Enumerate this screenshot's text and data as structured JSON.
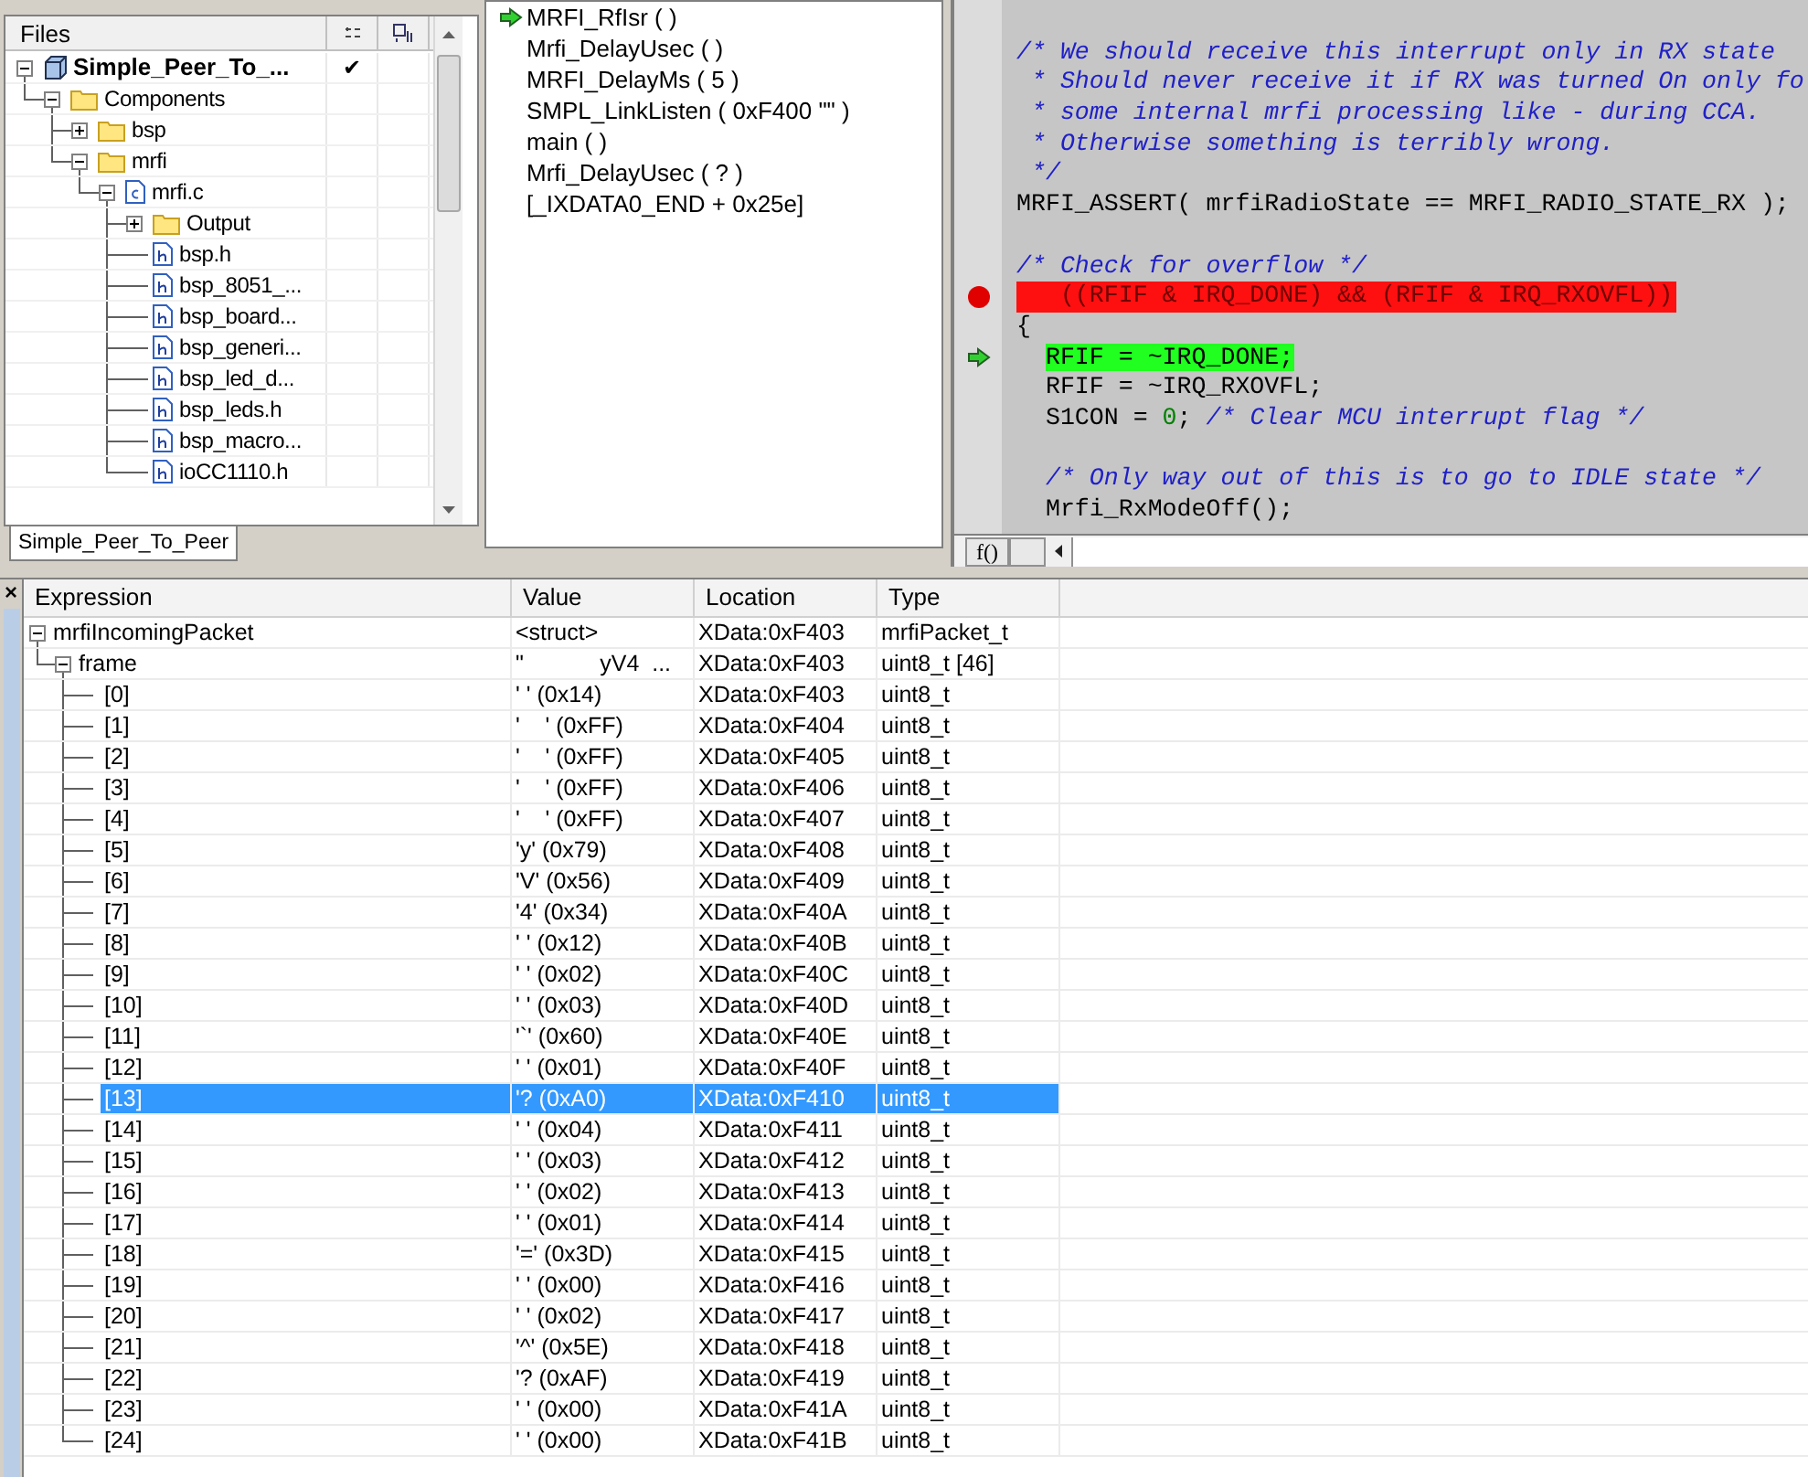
{
  "files_panel": {
    "title": "Files",
    "tree": [
      {
        "label": "Simple_Peer_To_...",
        "kind": "project",
        "expanded": true,
        "check": "✔",
        "children": [
          {
            "label": "Components",
            "kind": "folder",
            "expanded": true,
            "children": [
              {
                "label": "bsp",
                "kind": "folder",
                "expanded": false
              },
              {
                "label": "mrfi",
                "kind": "folder",
                "expanded": true,
                "children": [
                  {
                    "label": "mrfi.c",
                    "kind": "c-file",
                    "expanded": true,
                    "children": [
                      {
                        "label": "Output",
                        "kind": "folder",
                        "expanded": false
                      },
                      {
                        "label": "bsp.h",
                        "kind": "h-file"
                      },
                      {
                        "label": "bsp_8051_...",
                        "kind": "h-file"
                      },
                      {
                        "label": "bsp_board...",
                        "kind": "h-file"
                      },
                      {
                        "label": "bsp_generi...",
                        "kind": "h-file"
                      },
                      {
                        "label": "bsp_led_d...",
                        "kind": "h-file"
                      },
                      {
                        "label": "bsp_leds.h",
                        "kind": "h-file"
                      },
                      {
                        "label": "bsp_macro...",
                        "kind": "h-file"
                      },
                      {
                        "label": "ioCC1110.h",
                        "kind": "h-file"
                      }
                    ]
                  }
                ]
              }
            ]
          }
        ]
      }
    ],
    "tabs": [
      {
        "label": "Simple_Peer_To_Peer",
        "selected": true
      }
    ]
  },
  "call_stack": [
    {
      "label": "MRFI_RfIsr ( )",
      "current": true
    },
    {
      "label": "Mrfi_DelayUsec ( )",
      "current": false
    },
    {
      "label": "MRFI_DelayMs ( 5 )",
      "current": false
    },
    {
      "label": "SMPL_LinkListen ( 0xF400 \"\" )",
      "current": false
    },
    {
      "label": "main ( )",
      "current": false
    },
    {
      "label": "Mrfi_DelayUsec ( ? )",
      "current": false
    },
    {
      "label": "[_IXDATA0_END + 0x25e]",
      "current": false
    }
  ],
  "editor": {
    "lines": [
      {
        "blank_line_before": true,
        "segments": [
          {
            "kind": "comment",
            "text": "/* We should receive this interrupt only in RX state"
          }
        ]
      },
      {
        "segments": [
          {
            "kind": "comment",
            "text": " * Should never receive it if RX was turned On only fo"
          }
        ]
      },
      {
        "segments": [
          {
            "kind": "comment",
            "text": " * some internal mrfi processing like - during CCA."
          }
        ]
      },
      {
        "segments": [
          {
            "kind": "comment",
            "text": " * Otherwise something is terribly wrong."
          }
        ]
      },
      {
        "segments": [
          {
            "kind": "comment",
            "text": " */"
          }
        ]
      },
      {
        "segments": [
          {
            "kind": "code",
            "text": "MRFI_ASSERT( mrfiRadioState == MRFI_RADIO_STATE_RX );"
          }
        ]
      },
      {
        "blank_line_before": true,
        "segments": [
          {
            "kind": "comment",
            "text": "/* Check for overflow */"
          }
        ]
      },
      {
        "breakpoint": true,
        "segments": [
          {
            "kind": "code",
            "text": "   ((RFIF & IRQ_DONE) && (RFIF & IRQ_RXOVFL))"
          }
        ]
      },
      {
        "segments": [
          {
            "kind": "code",
            "text": "{"
          }
        ]
      },
      {
        "current": true,
        "segments": [
          {
            "kind": "code",
            "text": "  RFIF = ~IRQ_DONE;"
          }
        ]
      },
      {
        "segments": [
          {
            "kind": "code",
            "text": "  RFIF = ~IRQ_RXOVFL;"
          }
        ]
      },
      {
        "segments": [
          {
            "kind": "code",
            "text": "  S1CON = "
          },
          {
            "kind": "number",
            "text": "0"
          },
          {
            "kind": "code",
            "text": "; "
          },
          {
            "kind": "comment",
            "text": "/* Clear MCU interrupt flag */"
          }
        ]
      },
      {
        "blank_line_before": true,
        "segments": [
          {
            "kind": "comment",
            "text": "  /* Only way out of this is to go to IDLE state */"
          }
        ]
      },
      {
        "segments": [
          {
            "kind": "code",
            "text": "  Mrfi_RxModeOff();"
          }
        ]
      }
    ],
    "bottom_button": "f()"
  },
  "watch": {
    "close": "×",
    "columns": [
      "Expression",
      "Value",
      "Location",
      "Type"
    ],
    "rows": [
      {
        "expression": "mrfiIncomingPacket",
        "value": "<struct>",
        "location": "XData:0xF403",
        "type": "mrfiPacket_t",
        "expanded": true,
        "selected": false,
        "children": [
          {
            "expression": "frame",
            "value": "\"            yV4  ...",
            "location": "XData:0xF403",
            "type": "uint8_t [46]",
            "expanded": true,
            "selected": false,
            "children": [
              {
                "expression": "[0]",
                "value": "' ' (0x14)",
                "location": "XData:0xF403",
                "type": "uint8_t",
                "selected": false
              },
              {
                "expression": "[1]",
                "value": "'    ' (0xFF)",
                "location": "XData:0xF404",
                "type": "uint8_t",
                "selected": false
              },
              {
                "expression": "[2]",
                "value": "'    ' (0xFF)",
                "location": "XData:0xF405",
                "type": "uint8_t",
                "selected": false
              },
              {
                "expression": "[3]",
                "value": "'    ' (0xFF)",
                "location": "XData:0xF406",
                "type": "uint8_t",
                "selected": false
              },
              {
                "expression": "[4]",
                "value": "'    ' (0xFF)",
                "location": "XData:0xF407",
                "type": "uint8_t",
                "selected": false
              },
              {
                "expression": "[5]",
                "value": "'y' (0x79)",
                "location": "XData:0xF408",
                "type": "uint8_t",
                "selected": false
              },
              {
                "expression": "[6]",
                "value": "'V' (0x56)",
                "location": "XData:0xF409",
                "type": "uint8_t",
                "selected": false
              },
              {
                "expression": "[7]",
                "value": "'4' (0x34)",
                "location": "XData:0xF40A",
                "type": "uint8_t",
                "selected": false
              },
              {
                "expression": "[8]",
                "value": "' ' (0x12)",
                "location": "XData:0xF40B",
                "type": "uint8_t",
                "selected": false
              },
              {
                "expression": "[9]",
                "value": "' ' (0x02)",
                "location": "XData:0xF40C",
                "type": "uint8_t",
                "selected": false
              },
              {
                "expression": "[10]",
                "value": "' ' (0x03)",
                "location": "XData:0xF40D",
                "type": "uint8_t",
                "selected": false
              },
              {
                "expression": "[11]",
                "value": "'`' (0x60)",
                "location": "XData:0xF40E",
                "type": "uint8_t",
                "selected": false
              },
              {
                "expression": "[12]",
                "value": "' ' (0x01)",
                "location": "XData:0xF40F",
                "type": "uint8_t",
                "selected": false
              },
              {
                "expression": "[13]",
                "value": "'? (0xA0)",
                "location": "XData:0xF410",
                "type": "uint8_t",
                "selected": true
              },
              {
                "expression": "[14]",
                "value": "' ' (0x04)",
                "location": "XData:0xF411",
                "type": "uint8_t",
                "selected": false
              },
              {
                "expression": "[15]",
                "value": "' ' (0x03)",
                "location": "XData:0xF412",
                "type": "uint8_t",
                "selected": false
              },
              {
                "expression": "[16]",
                "value": "' ' (0x02)",
                "location": "XData:0xF413",
                "type": "uint8_t",
                "selected": false
              },
              {
                "expression": "[17]",
                "value": "' ' (0x01)",
                "location": "XData:0xF414",
                "type": "uint8_t",
                "selected": false
              },
              {
                "expression": "[18]",
                "value": "'=' (0x3D)",
                "location": "XData:0xF415",
                "type": "uint8_t",
                "selected": false
              },
              {
                "expression": "[19]",
                "value": "' ' (0x00)",
                "location": "XData:0xF416",
                "type": "uint8_t",
                "selected": false
              },
              {
                "expression": "[20]",
                "value": "' ' (0x02)",
                "location": "XData:0xF417",
                "type": "uint8_t",
                "selected": false
              },
              {
                "expression": "[21]",
                "value": "'^' (0x5E)",
                "location": "XData:0xF418",
                "type": "uint8_t",
                "selected": false
              },
              {
                "expression": "[22]",
                "value": "'? (0xAF)",
                "location": "XData:0xF419",
                "type": "uint8_t",
                "selected": false
              },
              {
                "expression": "[23]",
                "value": "' ' (0x00)",
                "location": "XData:0xF41A",
                "type": "uint8_t",
                "selected": false
              },
              {
                "expression": "[24]",
                "value": "' ' (0x00)",
                "location": "XData:0xF41B",
                "type": "uint8_t",
                "selected": false
              }
            ]
          }
        ]
      }
    ]
  }
}
